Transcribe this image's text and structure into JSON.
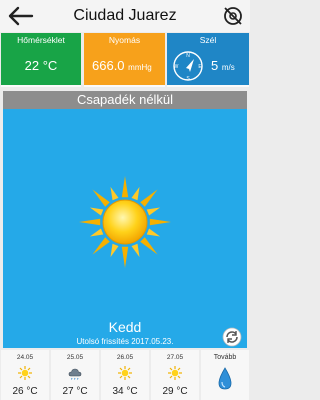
{
  "header": {
    "title": "Ciudad Juarez",
    "back_icon": "arrow-left-icon",
    "settings_icon": "gear-circle-icon"
  },
  "tiles": {
    "temperature": {
      "label": "Hőmérséklet",
      "value": "22 °C",
      "color": "#18a447"
    },
    "pressure": {
      "label": "Nyomás",
      "value": "666.0",
      "unit": "mmHg",
      "color": "#f7a11b"
    },
    "wind": {
      "label": "Szél",
      "value": "5",
      "unit": "m/s",
      "icon": "compass-icon",
      "color": "#1f86c6"
    }
  },
  "status": {
    "text": "Csapadék nélkül"
  },
  "main": {
    "icon": "sun-icon",
    "day": "Kedd",
    "updated": "Utolsó frissítés 2017.05.23.",
    "refresh_icon": "refresh-icon",
    "background_color": "#25a9e8"
  },
  "forecast": [
    {
      "date": "24.05",
      "icon": "sun-icon",
      "temp": "26 °C"
    },
    {
      "date": "25.05",
      "icon": "cloud-icon",
      "temp": "27 °C"
    },
    {
      "date": "26.05",
      "icon": "sun-icon",
      "temp": "34 °C"
    },
    {
      "date": "27.05",
      "icon": "sun-icon",
      "temp": "29 °C"
    }
  ],
  "more": {
    "label": "Tovább",
    "icon": "water-drop-icon"
  }
}
